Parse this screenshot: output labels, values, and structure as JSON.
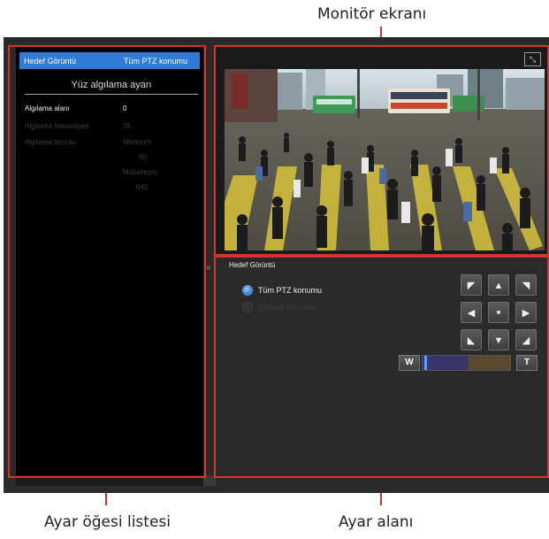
{
  "callouts": {
    "monitor": "Monitör ekranı",
    "item_list": "Ayar öğesi listesi",
    "settings_area": "Ayar alanı"
  },
  "left_panel": {
    "header": {
      "col1": "Hedef Görüntü",
      "col2": "Tüm PTZ konumu"
    },
    "section_title": "Yüz algılama ayarı",
    "fields": [
      {
        "label": "Algılama alanı",
        "value": "0",
        "enabled": true
      },
      {
        "label": "Algılama hassasiyeti",
        "value": "35",
        "enabled": false
      },
      {
        "label": "Algılama boyutu",
        "min_label": "Minimum",
        "min_value": "80",
        "max_label": "Maksimum",
        "max_value": "640",
        "enabled": false
      }
    ],
    "collapse_icon": "«"
  },
  "monitor": {
    "expand_icon": "fullscreen-icon",
    "expand_glyph": "⤡",
    "scene": "city-crosswalk-camera-feed"
  },
  "settings": {
    "title": "Hedef Görüntü",
    "options": [
      {
        "label": "Tüm PTZ konumu",
        "selected": true
      },
      {
        "label": "Önayar konumu",
        "selected": false
      }
    ],
    "ptz_buttons": {
      "up_left": "◤",
      "up": "▲",
      "up_right": "◥",
      "left": "◀",
      "home": "■",
      "right": "▶",
      "down_left": "◣",
      "down": "▼",
      "down_right": "◢"
    },
    "zoom": {
      "wide_label": "W",
      "tele_label": "T",
      "position": 0.02
    }
  },
  "colors": {
    "accent": "#2f7bd6",
    "callout_red": "#d8332a"
  }
}
